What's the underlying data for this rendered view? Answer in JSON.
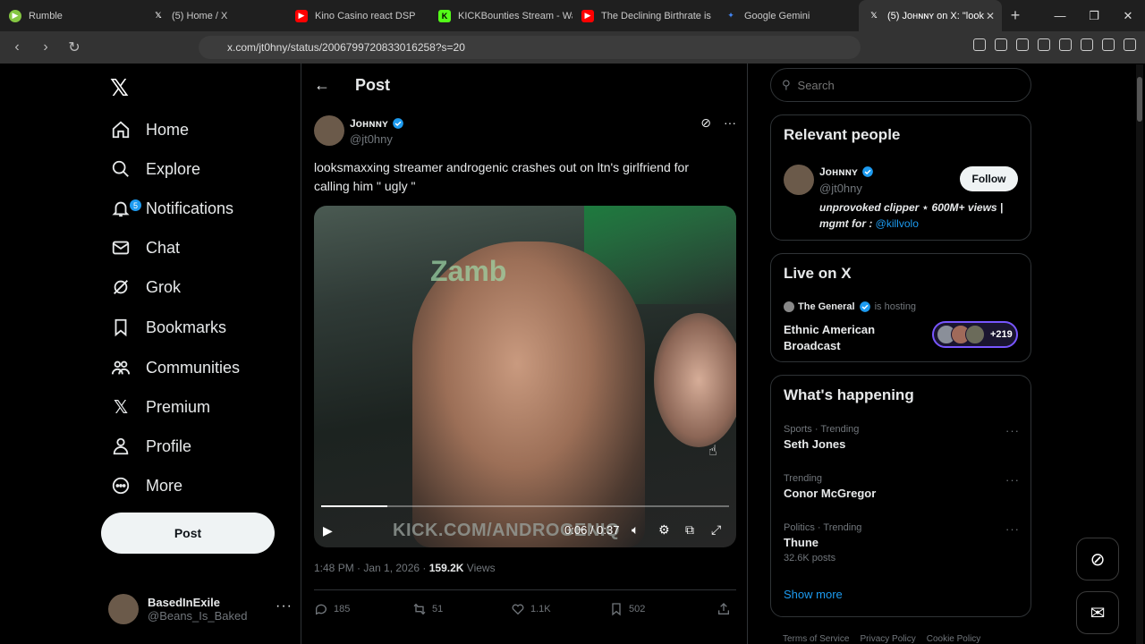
{
  "browser": {
    "tabs": [
      {
        "title": "Rumble",
        "color": "#85c742",
        "active": false
      },
      {
        "title": "(5) Home / X",
        "color": "#000000",
        "active": false
      },
      {
        "title": "Kino Casino react DSP",
        "color": "#ff0000",
        "active": false
      },
      {
        "title": "KICKBounties Stream - Wa",
        "color": "#53fc18",
        "active": false
      },
      {
        "title": "The Declining Birthrate is",
        "color": "#ff0000",
        "active": false
      },
      {
        "title": "Google Gemini",
        "color": "#4285f4",
        "active": false
      },
      {
        "title": "(5) Jᴏʜɴɴʏ on X: \"look",
        "color": "#000000",
        "active": true
      }
    ],
    "url": "x.com/jt0hny/status/2006799720833016258?s=20"
  },
  "nav": {
    "items": [
      {
        "label": "Home",
        "icon": "home-icon"
      },
      {
        "label": "Explore",
        "icon": "search-icon"
      },
      {
        "label": "Notifications",
        "icon": "bell-icon",
        "badge": "5"
      },
      {
        "label": "Chat",
        "icon": "mail-icon"
      },
      {
        "label": "Grok",
        "icon": "grok-icon"
      },
      {
        "label": "Bookmarks",
        "icon": "bookmark-icon"
      },
      {
        "label": "Communities",
        "icon": "people-icon"
      },
      {
        "label": "Premium",
        "icon": "x-icon"
      },
      {
        "label": "Profile",
        "icon": "person-icon"
      },
      {
        "label": "More",
        "icon": "more-circle-icon"
      }
    ],
    "post_label": "Post",
    "account": {
      "name": "BasedInExile",
      "handle": "@Beans_Is_Baked"
    }
  },
  "main": {
    "title": "Post",
    "author": {
      "name": "Jᴏʜɴɴʏ",
      "handle": "@jt0hny"
    },
    "text": "looksmaxxing streamer androgenic crashes out on ltn's girlfriend for calling him \" ugly \"",
    "video": {
      "overlay": "KICK.COM/ANDROGENIQ",
      "time": "0:06 / 0:37",
      "progress": 0.162
    },
    "meta": {
      "time": "1:48 PM · Jan 1, 2026 ·",
      "views_num": "159.2K",
      "views_label": "Views"
    },
    "actions": {
      "replies": "185",
      "reposts": "51",
      "likes": "1.1K",
      "bookmarks": "502"
    }
  },
  "right": {
    "search_placeholder": "Search",
    "relevant": {
      "title": "Relevant people",
      "name": "Jᴏʜɴɴʏ",
      "handle": "@jt0hny",
      "follow": "Follow",
      "bio": "unprovoked clipper ⋆ 600M+ views | mgmt for :",
      "bio_link": "@killvolo"
    },
    "live": {
      "title": "Live on X",
      "host": "The General",
      "hosting": "is hosting",
      "space": "Ethnic American Broadcast",
      "count": "+219"
    },
    "happening": {
      "title": "What's happening",
      "trends": [
        {
          "meta": "Sports · Trending",
          "title": "Seth Jones",
          "count": ""
        },
        {
          "meta": "Trending",
          "title": "Conor McGregor",
          "count": ""
        },
        {
          "meta": "Politics · Trending",
          "title": "Thune",
          "count": "32.6K posts"
        }
      ],
      "show_more": "Show more"
    },
    "footer": [
      "Terms of Service",
      "Privacy Policy",
      "Cookie Policy"
    ]
  }
}
